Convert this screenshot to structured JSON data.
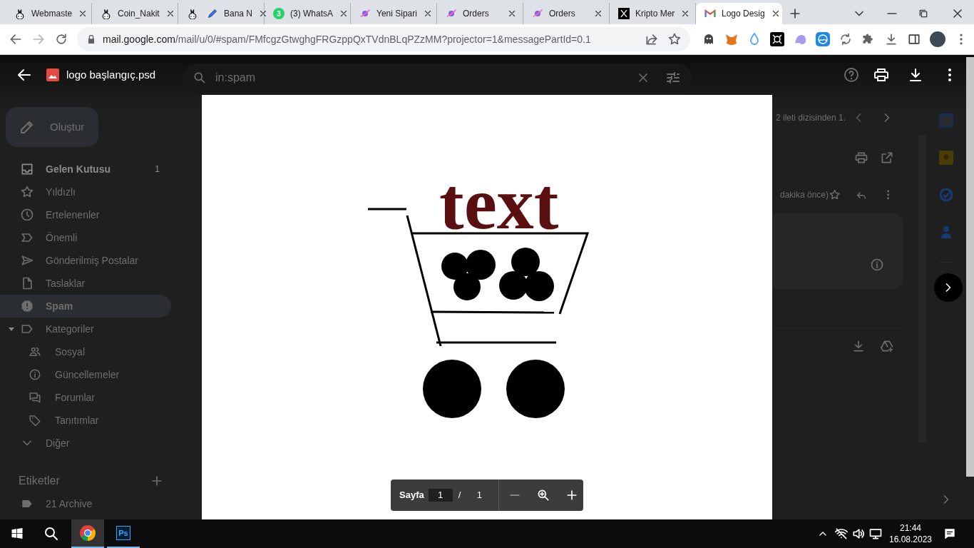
{
  "browser": {
    "tabs": [
      {
        "title": "Webmaste",
        "selected": false
      },
      {
        "title": "Coin_Nakit",
        "selected": false
      },
      {
        "title": "Bana N",
        "selected": false
      },
      {
        "title": "(3) WhatsA",
        "badge": "3",
        "selected": false
      },
      {
        "title": "Yeni Sipari",
        "selected": false
      },
      {
        "title": "Orders",
        "selected": false
      },
      {
        "title": "Orders",
        "selected": false
      },
      {
        "title": "Kripto Mer",
        "selected": false
      },
      {
        "title": "Logo Desig",
        "selected": true
      }
    ],
    "address": {
      "host": "mail.google.com",
      "path": "/mail/u/0/#spam/FMfcgzGtwghgFRGzppQxTVdnBLqPZzMM?projector=1&messagePartId=0.1"
    }
  },
  "gmail": {
    "search": {
      "value": "in:spam"
    },
    "compose": "Oluştur",
    "nav": [
      {
        "label": "Gelen Kutusu",
        "count": "1",
        "unread": true,
        "selected": false
      },
      {
        "label": "Yıldızlı",
        "unread": false,
        "selected": false
      },
      {
        "label": "Ertelenenler",
        "unread": false,
        "selected": false
      },
      {
        "label": "Önemli",
        "unread": false,
        "selected": false
      },
      {
        "label": "Gönderilmiş Postalar",
        "unread": false,
        "selected": false
      },
      {
        "label": "Taslaklar",
        "unread": false,
        "selected": false
      },
      {
        "label": "Spam",
        "unread": false,
        "selected": true
      },
      {
        "label": "Kategoriler",
        "unread": false,
        "selected": false,
        "expanded": true,
        "children": [
          {
            "label": "Sosyal",
            "selected": false
          },
          {
            "label": "Güncellemeler",
            "selected": false
          },
          {
            "label": "Forumlar",
            "selected": false
          },
          {
            "label": "Tanıtımlar",
            "selected": false
          }
        ]
      },
      {
        "label": "Diğer",
        "unread": false,
        "selected": false
      }
    ],
    "labels_heading": "Etiketler",
    "labels": [
      "21 Archive"
    ],
    "thread_position": "2 ileti dizisinden 1.",
    "message_time": "dakika önce)"
  },
  "viewer": {
    "filename": "logo başlangıç.psd",
    "logo_text": "text",
    "pager": {
      "label": "Sayfa",
      "page": "1",
      "separator": "/",
      "total": "1"
    }
  },
  "taskbar": {
    "apps": [
      {
        "selected": true
      },
      {
        "label": "Ps",
        "selected": false
      }
    ],
    "time": "21:44",
    "date": "16.08.2023"
  }
}
